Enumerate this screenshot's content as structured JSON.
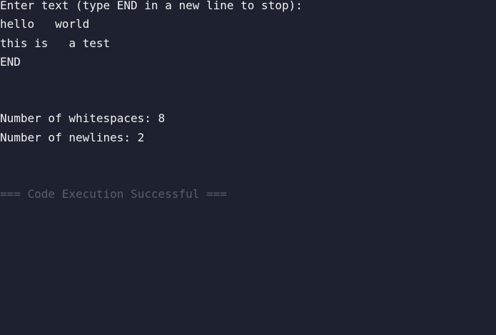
{
  "console": {
    "prompt": "Enter text (type END in a new line to stop):",
    "input_lines": [
      "hello   world",
      "this is   a test",
      "END"
    ],
    "results": [
      "Number of whitespaces: 8",
      "Number of newlines: 2"
    ],
    "status": "=== Code Execution Successful ===",
    "colors": {
      "background": "#1d2130",
      "text": "#f2f2f2",
      "status": "#5a5f6b"
    }
  }
}
